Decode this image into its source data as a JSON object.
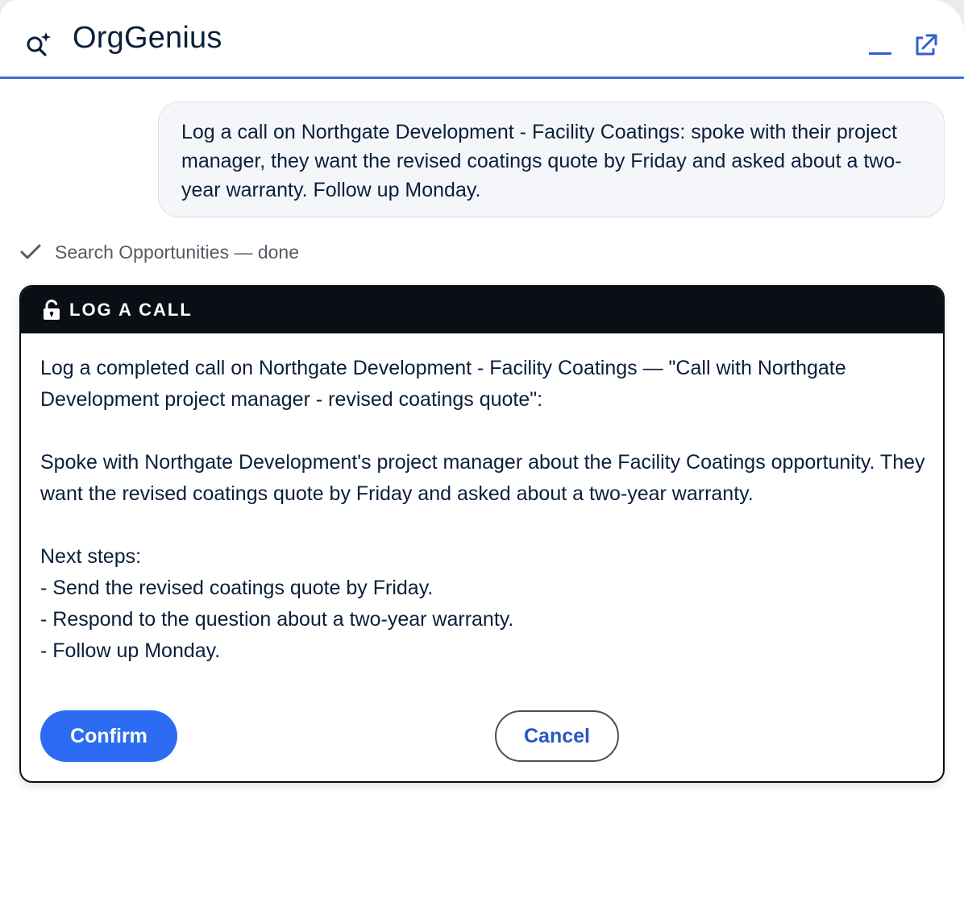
{
  "header": {
    "logo_icon": "search-sparkle-icon",
    "title": "OrgGenius",
    "minimize_icon": "minimize-icon",
    "popout_icon": "external-link-icon",
    "accent_color": "#3f72d6"
  },
  "conversation": {
    "user_message": "Log a call on Northgate Development - Facility Coatings: spoke with their project manager, they want the revised coatings quote by Friday and asked about a two-year warranty. Follow up Monday.",
    "status_icon": "checkmark-icon",
    "status_text": "Search Opportunities — done"
  },
  "action_card": {
    "icon": "lock-open-icon",
    "title": "LOG A CALL",
    "summary": "Log a completed call on Northgate Development - Facility Coatings — \"Call with Northgate Development project manager - revised coatings quote\":",
    "description": "Spoke with Northgate Development's project manager about the Facility Coatings opportunity. They want the revised coatings quote by Friday and asked about a two-year warranty.",
    "next_steps_heading": "Next steps:",
    "next_steps": [
      "- Send the revised coatings quote by Friday.",
      "- Respond to the question about a two-year warranty.",
      "- Follow up Monday."
    ],
    "confirm_label": "Confirm",
    "cancel_label": "Cancel",
    "confirm_color": "#2c6cf2"
  }
}
